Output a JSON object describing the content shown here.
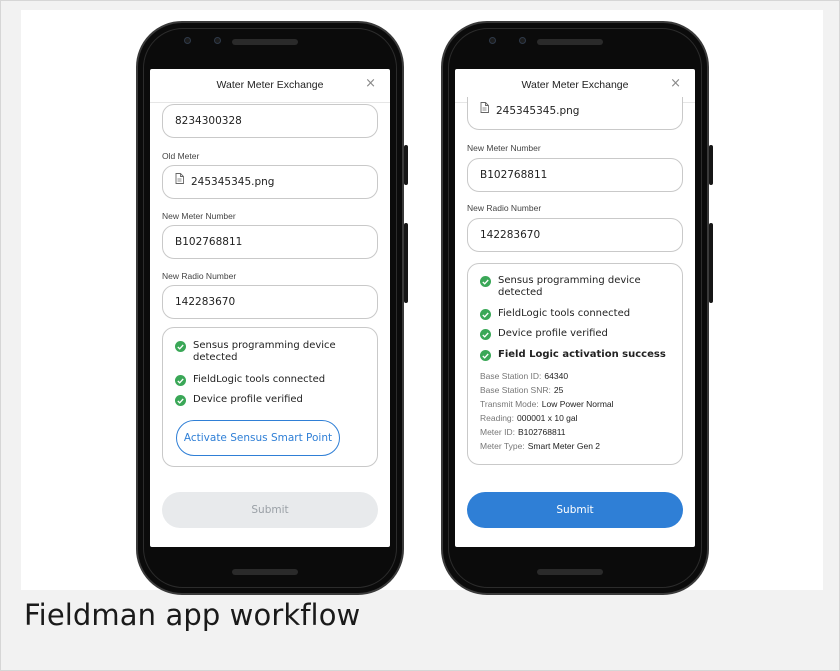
{
  "caption": "Fieldman app workflow",
  "colors": {
    "accent": "#2f7fd6",
    "success": "#3aa757",
    "disabled_bg": "#e8eaec"
  },
  "phones": [
    {
      "header": {
        "title": "Water Meter Exchange",
        "close_icon": "×"
      },
      "top_field_value": "8234300328",
      "old_meter": {
        "label": "Old Meter",
        "file_name": "245345345.png",
        "icon": "file-icon"
      },
      "new_meter": {
        "label": "New Meter Number",
        "value": "B102768811"
      },
      "new_radio": {
        "label": "New Radio Number",
        "value": "142283670"
      },
      "checks": [
        {
          "text": "Sensus programming device detected",
          "icon": "check-icon"
        },
        {
          "text": "FieldLogic tools connected",
          "icon": "check-icon"
        },
        {
          "text": "Device profile verified",
          "icon": "check-icon"
        }
      ],
      "activate_label": "Activate Sensus Smart Point",
      "submit_label": "Submit",
      "submit_state": "disabled"
    },
    {
      "header": {
        "title": "Water Meter Exchange",
        "close_icon": "×"
      },
      "top_file_name": "245345345.png",
      "new_meter": {
        "label": "New Meter Number",
        "value": "B102768811"
      },
      "new_radio": {
        "label": "New Radio Number",
        "value": "142283670"
      },
      "checks": [
        {
          "text": "Sensus programming device detected",
          "icon": "check-icon"
        },
        {
          "text": "FieldLogic tools connected",
          "icon": "check-icon"
        },
        {
          "text": "Device profile verified",
          "icon": "check-icon"
        },
        {
          "text": "Field Logic activation success",
          "icon": "check-icon"
        }
      ],
      "details": [
        {
          "label": "Base Station ID:",
          "value": "64340"
        },
        {
          "label": "Base Station SNR:",
          "value": "25"
        },
        {
          "label": "Transmit Mode:",
          "value": "Low Power Normal"
        },
        {
          "label": "Reading:",
          "value": "000001 x 10 gal"
        },
        {
          "label": "Meter ID:",
          "value": "B102768811"
        },
        {
          "label": "Meter Type:",
          "value": "Smart Meter Gen 2"
        }
      ],
      "submit_label": "Submit",
      "submit_state": "enabled"
    }
  ]
}
